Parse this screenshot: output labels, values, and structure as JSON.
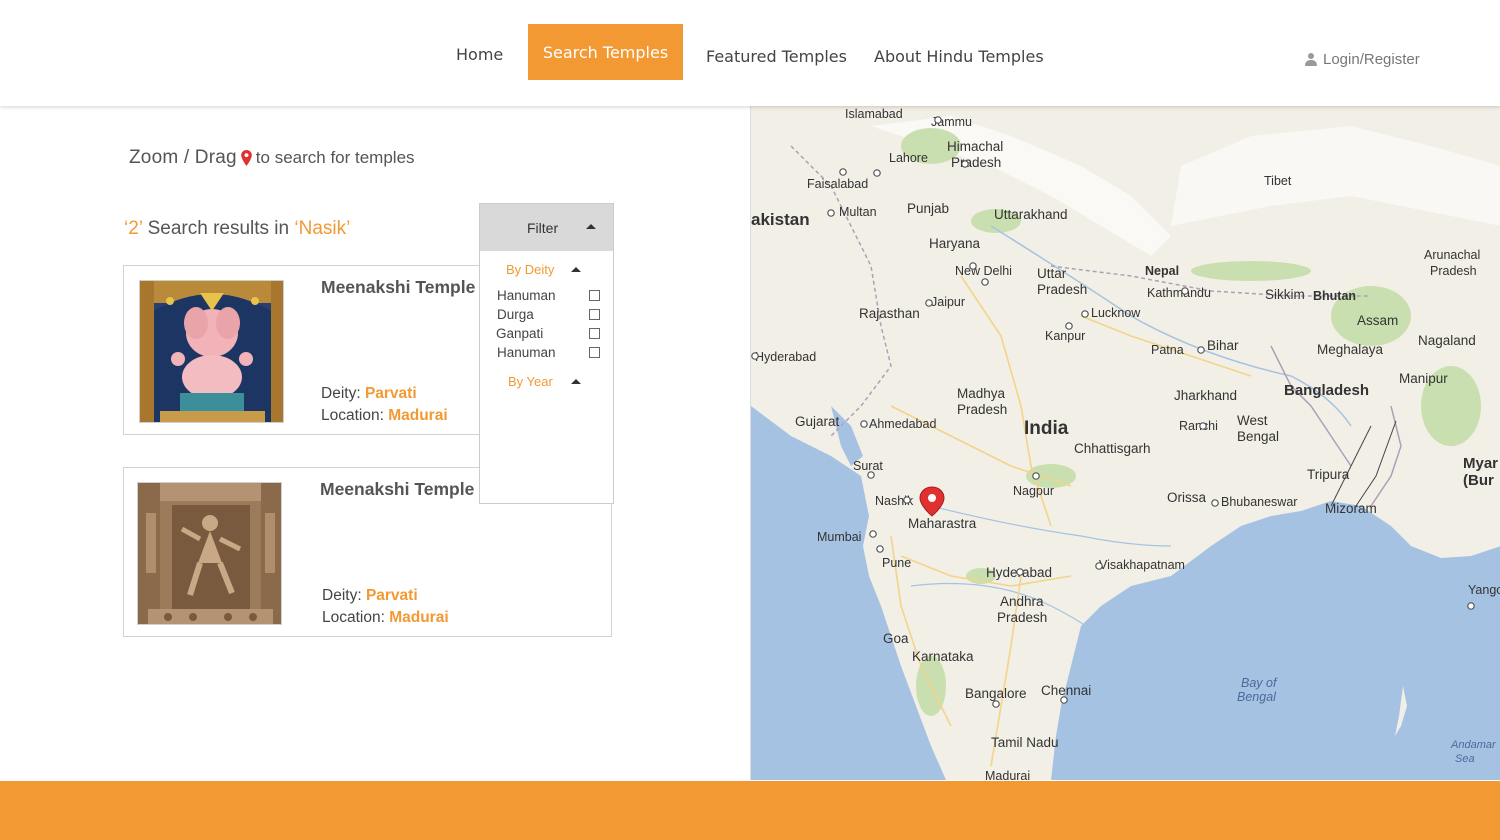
{
  "nav": {
    "home": "Home",
    "search": "Search Temples",
    "featured": "Featured Temples",
    "about": "About Hindu Temples",
    "login": "Login/Register"
  },
  "hint": {
    "part1": "Zoom / Drag",
    "part2": "to search for temples"
  },
  "results": {
    "count": "‘2’",
    "middle": " Search results in ",
    "city": "‘Nasik’"
  },
  "cards": [
    {
      "title": "Meenakshi Temple",
      "deity_label": "Deity: ",
      "deity": "Parvati",
      "location_label": "Location: ",
      "location": "Madurai"
    },
    {
      "title": "Meenakshi Temple",
      "deity_label": "Deity: ",
      "deity": "Parvati",
      "location_label": "Location: ",
      "location": "Madurai"
    }
  ],
  "filter": {
    "title": "Filter",
    "by_deity": "By Deity",
    "options": [
      "Hanuman",
      "Durga",
      "Ganpati",
      "Hanuman"
    ],
    "by_year": "By Year"
  },
  "map": {
    "labels": {
      "islamabad": "Islamabad",
      "jammu": "Jammu",
      "himachal": "Himachal",
      "pradesh_hp": "Pradesh",
      "lahore": "Lahore",
      "faisalabad": "Faisalabad",
      "tibet": "Tibet",
      "pakistan": "akistan",
      "multan": "Multan",
      "punjab": "Punjab",
      "uttarakhand": "Uttarakhand",
      "haryana": "Haryana",
      "arunachal": "Arunachal",
      "pradesh_ar": "Pradesh",
      "new_delhi": "New Delhi",
      "uttar": "Uttar",
      "pradesh_up": "Pradesh",
      "nepal": "Nepal",
      "kathmandu": "Kathmandu",
      "sikkim": "Sikkim",
      "bhutan": "Bhutan",
      "jaipur": "Jaipur",
      "rajasthan": "Rajasthan",
      "lucknow": "Lucknow",
      "assam": "Assam",
      "kanpur": "Kanpur",
      "nagaland": "Nagaland",
      "hyderabad_pk": "Hyderabad",
      "patna": "Patna",
      "bihar": "Bihar",
      "meghalaya": "Meghalaya",
      "manipur": "Manipur",
      "bangladesh": "Bangladesh",
      "jharkhand": "Jharkhand",
      "madhya": "Madhya",
      "pradesh_mp": "Pradesh",
      "gujarat": "Gujarat",
      "ahmedabad": "Ahmedabad",
      "india": "India",
      "ranchi": "Ranchi",
      "west": "West",
      "bengal": "Bengal",
      "chhattisgarh": "Chhattisgarh",
      "myanmar1": "Myar",
      "myanmar2": "(Bur",
      "surat": "Surat",
      "tripura": "Tripura",
      "nashik": "Nashik",
      "nagpur": "Nagpur",
      "orissa": "Orissa",
      "bhubaneswar": "Bhubaneswar",
      "mizoram": "Mizoram",
      "maharastra": "Maharastra",
      "mumbai": "Mumbai",
      "pune": "Pune",
      "visakhapatnam": "Visakhapatnam",
      "hyderabad": "Hyderabad",
      "yango": "Yango",
      "andhra": "Andhra",
      "pradesh_ap": "Pradesh",
      "goa": "Goa",
      "karnataka": "Karnataka",
      "bay": "Bay of",
      "bengal_bay": "Bengal",
      "bangalore": "Bangalore",
      "chennai": "Chennai",
      "tamil_nadu": "Tamil Nadu",
      "andaman": "Andamar",
      "sea": "Sea",
      "madurai": "Madurai"
    }
  },
  "colors": {
    "accent": "#f39933",
    "land": "#f2efe6",
    "water": "#a6c2e3",
    "pin": "#e03030"
  }
}
